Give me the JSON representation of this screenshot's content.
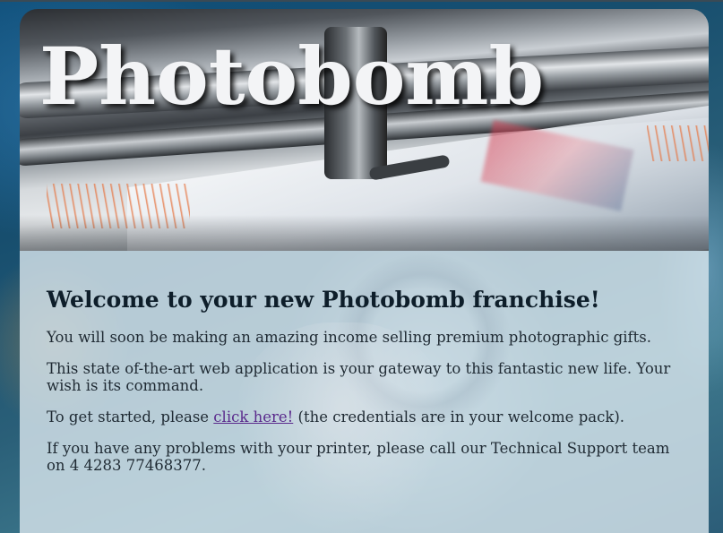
{
  "header": {
    "title": "Photobomb"
  },
  "main": {
    "heading": "Welcome to your new Photobomb franchise!",
    "paragraph1": "You will soon be making an amazing income selling premium photographic gifts.",
    "paragraph2": "This state of-the-art web application is your gateway to this fantastic new life. Your wish is its command.",
    "paragraph3_before": "To get started, please ",
    "paragraph3_link": "click here!",
    "paragraph3_after": " (the credentials are in your welcome pack).",
    "paragraph4": "If you have any problems with your printer, please call our Technical Support team on 4 4283 77468377."
  },
  "colors": {
    "link": "#5a2a8c",
    "heading": "#0e1e2a",
    "title": "#f3f4f6"
  }
}
